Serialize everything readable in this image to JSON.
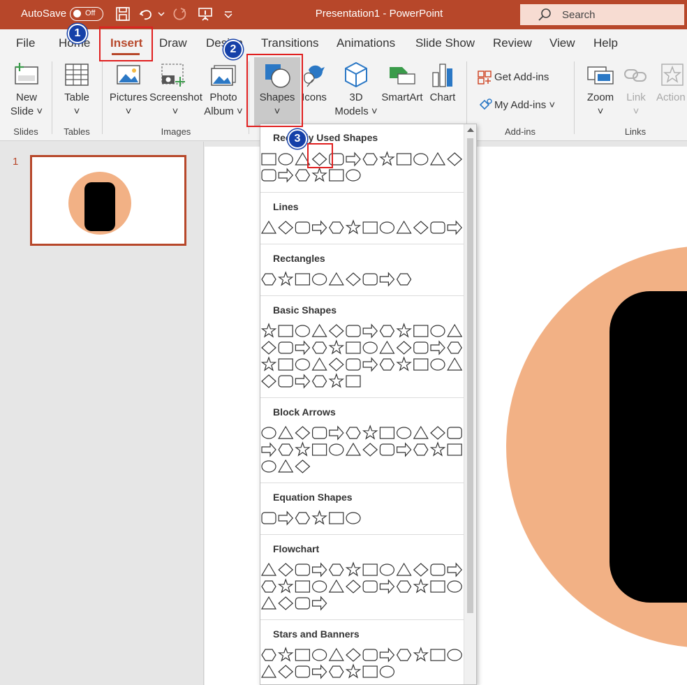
{
  "titlebar": {
    "autosave_label": "AutoSave",
    "autosave_state": "Off",
    "title": "Presentation1  -  PowerPoint",
    "search_placeholder": "Search",
    "background_color": "#b7472a"
  },
  "tabs": [
    {
      "label": "File"
    },
    {
      "label": "Home"
    },
    {
      "label": "Insert",
      "active": true
    },
    {
      "label": "Draw"
    },
    {
      "label": "Design"
    },
    {
      "label": "Transitions"
    },
    {
      "label": "Animations"
    },
    {
      "label": "Slide Show"
    },
    {
      "label": "Review"
    },
    {
      "label": "View"
    },
    {
      "label": "Help"
    }
  ],
  "ribbon": {
    "new_slide": {
      "line1": "New",
      "line2": "Slide ˅"
    },
    "table": {
      "line1": "Table",
      "line2": "˅"
    },
    "pictures": {
      "line1": "Pictures",
      "line2": "˅"
    },
    "screenshot": {
      "line1": "Screenshot",
      "line2": "˅"
    },
    "photo_album": {
      "line1": "Photo",
      "line2": "Album ˅"
    },
    "shapes": {
      "line1": "Shapes",
      "line2": "˅"
    },
    "icons": {
      "line1": "Icons"
    },
    "models3d": {
      "line1": "3D",
      "line2": "Models ˅"
    },
    "smartart": {
      "line1": "SmartArt"
    },
    "chart": {
      "line1": "Chart"
    },
    "get_addins": "Get Add-ins",
    "my_addins": "My Add-ins ˅",
    "zoom": {
      "line1": "Zoom",
      "line2": "˅"
    },
    "link": {
      "line1": "Link",
      "line2": "˅"
    },
    "action": {
      "line1": "Action"
    },
    "groups": {
      "slides": "Slides",
      "tables": "Tables",
      "images": "Images",
      "addins": "Add-ins",
      "links": "Links"
    }
  },
  "slides_pane": {
    "slide_number": "1"
  },
  "gallery": {
    "sections": [
      {
        "title": "Recently Used Shapes"
      },
      {
        "title": "Lines"
      },
      {
        "title": "Rectangles"
      },
      {
        "title": "Basic Shapes"
      },
      {
        "title": "Block Arrows"
      },
      {
        "title": "Equation Shapes"
      },
      {
        "title": "Flowchart"
      },
      {
        "title": "Stars and Banners"
      }
    ]
  },
  "callouts": [
    {
      "number": "1",
      "target": "Insert tab"
    },
    {
      "number": "2",
      "target": "Shapes button"
    },
    {
      "number": "3",
      "target": "Rectangle shape"
    }
  ],
  "colors": {
    "accent": "#b7472a",
    "callout_red": "#e01f1f",
    "badge_blue": "#1540a8",
    "slide_circle": "#f2b185",
    "slide_rect": "#000000"
  }
}
